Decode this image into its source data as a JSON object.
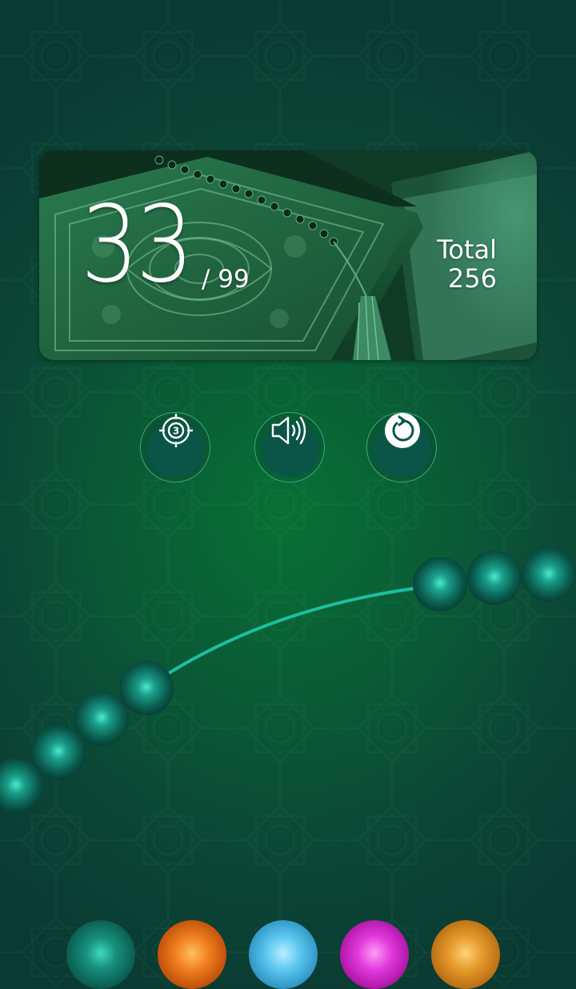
{
  "counter": {
    "count": "33",
    "target": "/ 99",
    "total_label": "Total",
    "total_value": "256"
  },
  "controls": [
    {
      "name": "target-button",
      "icon": "target-icon",
      "badge": "3"
    },
    {
      "name": "sound-button",
      "icon": "speaker-icon"
    },
    {
      "name": "reset-button",
      "icon": "reset-icon"
    }
  ],
  "bead_colors": [
    "teal",
    "orange",
    "blue",
    "pink",
    "amber"
  ],
  "colors": {
    "background": "#0a5a36",
    "bead": "#148a7a",
    "string": "#1ebfa2",
    "accent": "#39a883"
  }
}
